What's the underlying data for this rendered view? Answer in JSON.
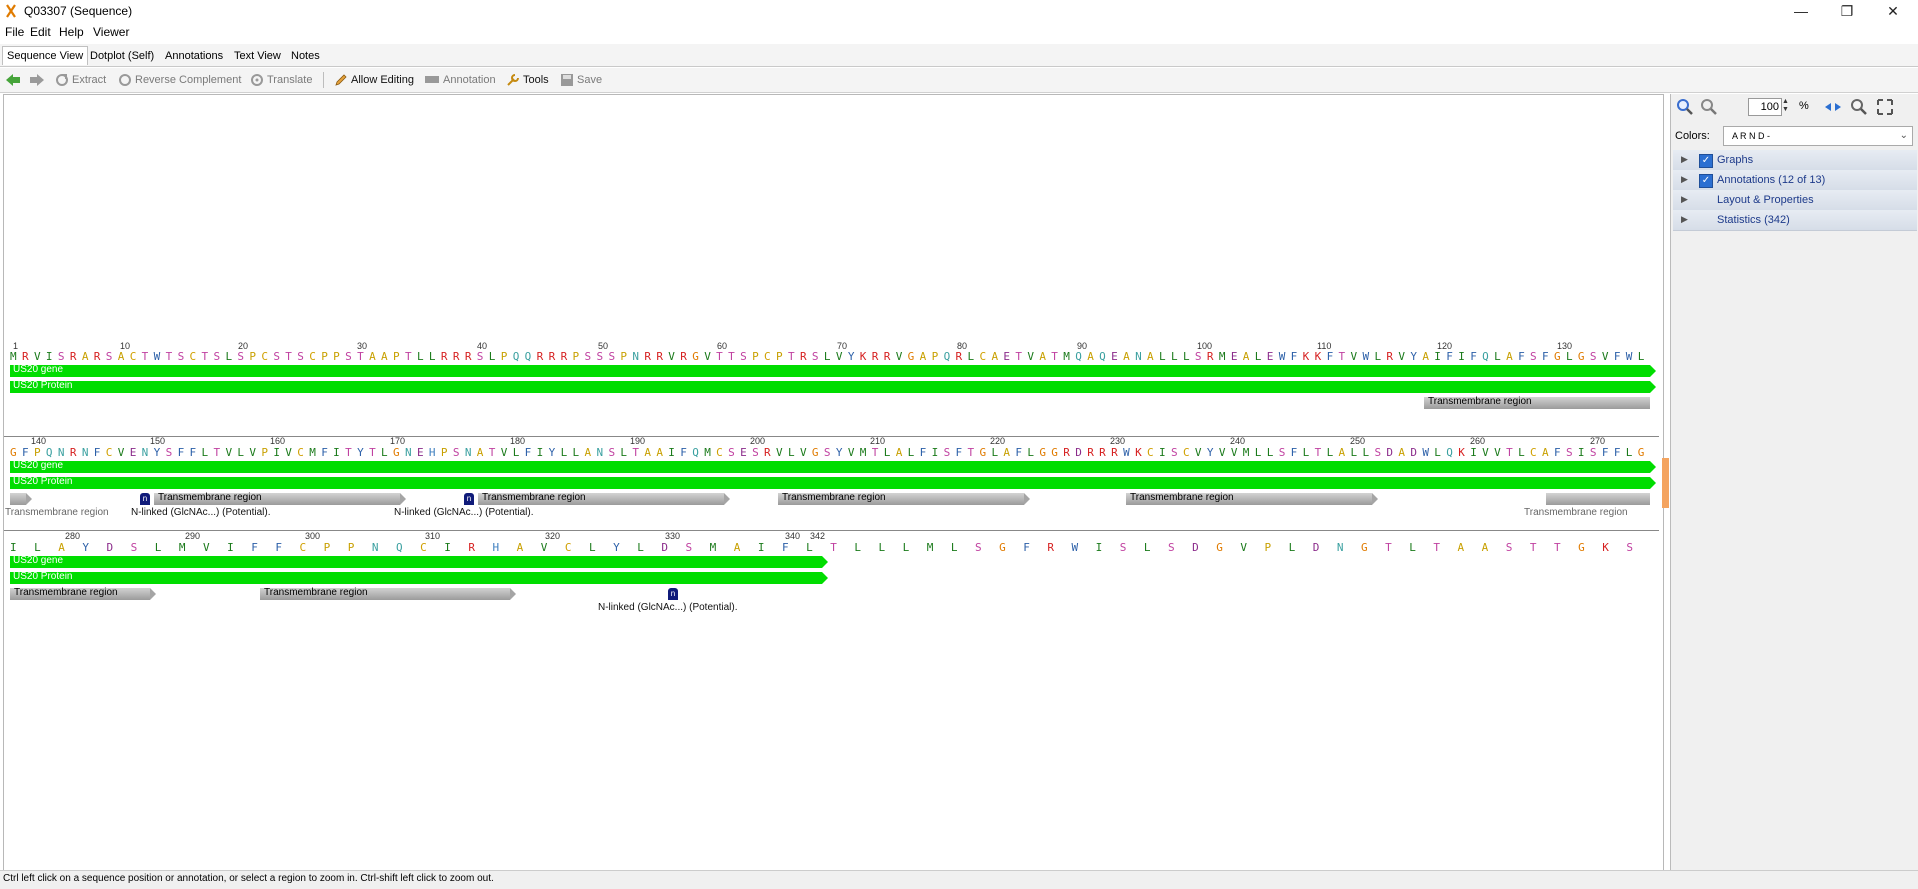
{
  "window": {
    "title": "Q03307 (Sequence)",
    "minimize": "—",
    "restore": "❐",
    "close": "✕"
  },
  "menu": [
    "File",
    "Edit",
    "Help",
    "Viewer"
  ],
  "tabs": [
    "Sequence View",
    "Dotplot (Self)",
    "Annotations",
    "Text View",
    "Notes"
  ],
  "toolbar": {
    "extract": "Extract",
    "reverse_complement": "Reverse Complement",
    "translate": "Translate",
    "allow_editing": "Allow Editing",
    "annotation": "Annotation",
    "tools": "Tools",
    "save": "Save"
  },
  "right_panel": {
    "zoom_value": "100",
    "zoom_unit": "%",
    "colors_label": "Colors:",
    "colors_value": "A R N D -",
    "sections": [
      {
        "label": "Graphs",
        "checked": true
      },
      {
        "label": "Annotations (12 of 13)",
        "checked": true
      },
      {
        "label": "Layout  &  Properties",
        "checked": false
      },
      {
        "label": "Statistics (342)",
        "checked": false
      }
    ]
  },
  "sequence": {
    "rows": [
      {
        "seq": "MRVISRARSACTWTSCTSLSPCSTSCPPSTAAPTLLRRRSLPQQRRRPSSSPNRRVRGVTTSPCPTRSLVYKRRVGAPQRLCAETVATMQAQEANALLLSRMEALEWFKKFTVWLRVYAIFIFQLAFSFGLGSVFWL",
        "ruler": [
          "1",
          "10",
          "20",
          "30",
          "40",
          "50",
          "60",
          "70",
          "80",
          "90",
          "100",
          "110",
          "120",
          "130"
        ],
        "gene_label": "US20 gene",
        "protein_label": "US20 Protein",
        "tm_label": "Transmembrane region"
      },
      {
        "seq": "GFPQNRNFCVENYSFFLTVLVPIVCMFITYTLGNEHPSNATVLFIYLLANSLTAAIFQMCSESRVLVGSYVMTLALFISFTGLAFLGGRDRRRWKCISCVYVVMLLSFLTLALLSDADWLQKIVVTLCAFSISFFLG",
        "ruler": [
          "140",
          "150",
          "160",
          "170",
          "180",
          "190",
          "200",
          "210",
          "220",
          "230",
          "240",
          "250",
          "260",
          "270"
        ],
        "gene_label": "US20 gene",
        "protein_label": "US20 Protein",
        "tm_labels": [
          "Transmembrane region",
          "Transmembrane region",
          "Transmembrane region",
          "Transmembrane region",
          "Transmembrane region"
        ],
        "below_labels": [
          "Transmembrane region",
          "N-linked (GlcNAc...) (Potential).",
          "N-linked (GlcNAc...) (Potential).",
          "Transmembrane region"
        ]
      },
      {
        "seq": "ILAYDSLMVIFFCPPNQCIRHAVCLYLDSMAIFLTLLLMLSGFRWISLSDGVPLDNGTLTAASTTGKS",
        "ruler": [
          "280",
          "290",
          "300",
          "310",
          "320",
          "330",
          "340",
          "342"
        ],
        "gene_label": "US20 gene",
        "protein_label": "US20 Protein",
        "tm_labels": [
          "Transmembrane region",
          "Transmembrane region"
        ],
        "below_labels": [
          "N-linked (GlcNAc...) (Potential)."
        ]
      }
    ],
    "glyco_icon": "n"
  },
  "status": "Ctrl left click on a sequence position or annotation, or select a region to zoom in. Ctrl-shift left click to zoom out.",
  "colors": {
    "green_bar": "#00dd00",
    "gray_bar": "#a5a5a5",
    "glyco": "#101b7a",
    "accent": "#2b6fd1"
  }
}
